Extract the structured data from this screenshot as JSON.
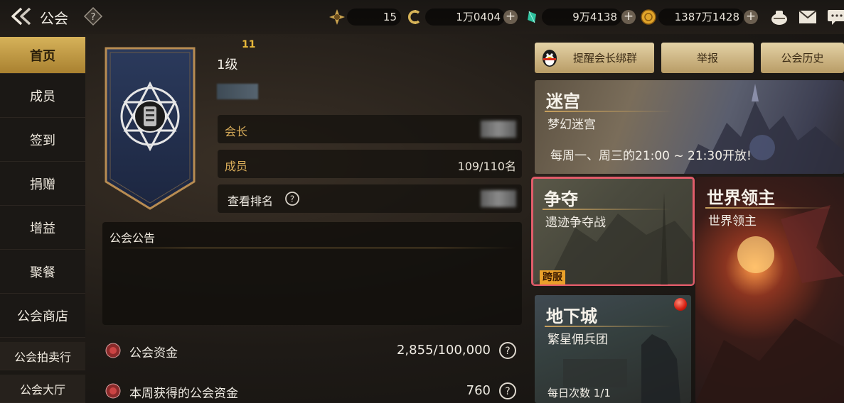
{
  "header": {
    "title": "公会",
    "resources": [
      {
        "icon": "energy-icon",
        "value": "15"
      },
      {
        "icon": "coin-c-icon",
        "value": "1万0404"
      },
      {
        "icon": "crystal-icon",
        "value": "9万4138"
      },
      {
        "icon": "gold-coin-icon",
        "value": "1387万1428"
      }
    ]
  },
  "nav": {
    "items": [
      {
        "label": "首页",
        "active": true
      },
      {
        "label": "成员"
      },
      {
        "label": "签到"
      },
      {
        "label": "捐赠"
      },
      {
        "label": "增益"
      },
      {
        "label": "聚餐"
      },
      {
        "label": "公会商店"
      },
      {
        "label": "公会拍卖行"
      },
      {
        "label": "公会大厅"
      }
    ]
  },
  "guild": {
    "level_number": "11",
    "level_text": "1级",
    "leader_label": "会长",
    "members_label": "成员",
    "members_value": "109/110名",
    "ranking_label": "查看排名"
  },
  "notice": {
    "title": "公会公告"
  },
  "funds": [
    {
      "label": "公会资金",
      "value": "2,855/100,000"
    },
    {
      "label": "本周获得的公会资金",
      "value": "760"
    }
  ],
  "actions": {
    "remind_leader": "提醒会长绑群",
    "report": "举报",
    "history": "公会历史"
  },
  "cards": {
    "maze": {
      "title": "迷宫",
      "subtitle": "梦幻迷宫",
      "desc": "每周一、周三的21:00 ~ 21:30开放!"
    },
    "contest": {
      "title": "争夺",
      "subtitle": "遗迹争夺战",
      "badge": "跨服"
    },
    "world_boss": {
      "title": "世界领主",
      "subtitle": "世界领主"
    },
    "dungeon": {
      "title": "地下城",
      "subtitle": "繁星佣兵团",
      "daily": "每日次数 1/1"
    }
  },
  "colors": {
    "accent_gold": "#d6b25a",
    "highlight_border": "#e25c6a",
    "badge_orange": "#e9a02a"
  }
}
